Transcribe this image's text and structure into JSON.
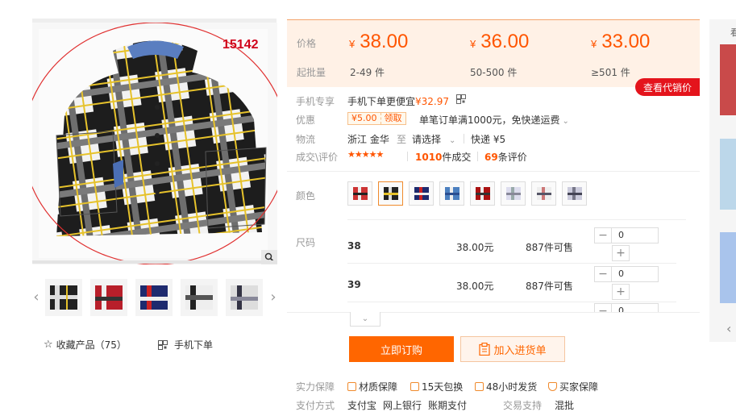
{
  "product": {
    "code": "15142",
    "favorite_label": "收藏产品（75）",
    "mobile_order_label": "手机下单"
  },
  "pricing": {
    "price_label": "价格",
    "batch_label": "起批量",
    "currency": "¥",
    "tiers": [
      {
        "price": "38.00",
        "qty": "2-49 件"
      },
      {
        "price": "36.00",
        "qty": "50-500 件"
      },
      {
        "price": "33.00",
        "qty": "≥501 件"
      }
    ],
    "agent_price_button": "查看代销价"
  },
  "details": {
    "mobile_label": "手机专享",
    "mobile_text": "手机下单更便宜",
    "mobile_price": "¥32.97",
    "promo_label": "优惠",
    "coupon_amount": "¥5.00",
    "coupon_get": "领取",
    "promo_text": "单笔订单满1000元，免快递运费",
    "shipping_label": "物流",
    "ship_from": "浙江 金华",
    "ship_to_word": "至",
    "ship_select": "请选择",
    "express": "快递 ¥5",
    "deal_label": "成交\\评价",
    "stars": "★★★★★",
    "deals_count": "1010",
    "deals_unit": "件成交",
    "reviews_count": "69",
    "reviews_unit": "条评价"
  },
  "colors": {
    "label": "颜色",
    "swatches": [
      "#c33",
      "#222",
      "#c22",
      "#4b7fbf",
      "#a11",
      "#9aa",
      "#c77",
      "#778"
    ],
    "selected_index": 1
  },
  "sizes": {
    "label": "尺码",
    "rows": [
      {
        "size": "38",
        "price": "38.00元",
        "stock": "887件可售",
        "quantity": "0"
      },
      {
        "size": "39",
        "price": "38.00元",
        "stock": "887件可售",
        "quantity": "0"
      }
    ],
    "partial_quantity": "0"
  },
  "actions": {
    "order_now": "立即订购",
    "add_to_cart": "加入进货单"
  },
  "guarantees": {
    "label": "实力保障",
    "items": [
      "材质保障",
      "15天包换",
      "48小时发货",
      "买家保障"
    ]
  },
  "payment": {
    "label": "支付方式",
    "methods": [
      "支付宝",
      "网上银行",
      "账期支付"
    ],
    "trade_label": "交易支持",
    "trade_value": "混批"
  },
  "side": {
    "top_text": "看"
  }
}
